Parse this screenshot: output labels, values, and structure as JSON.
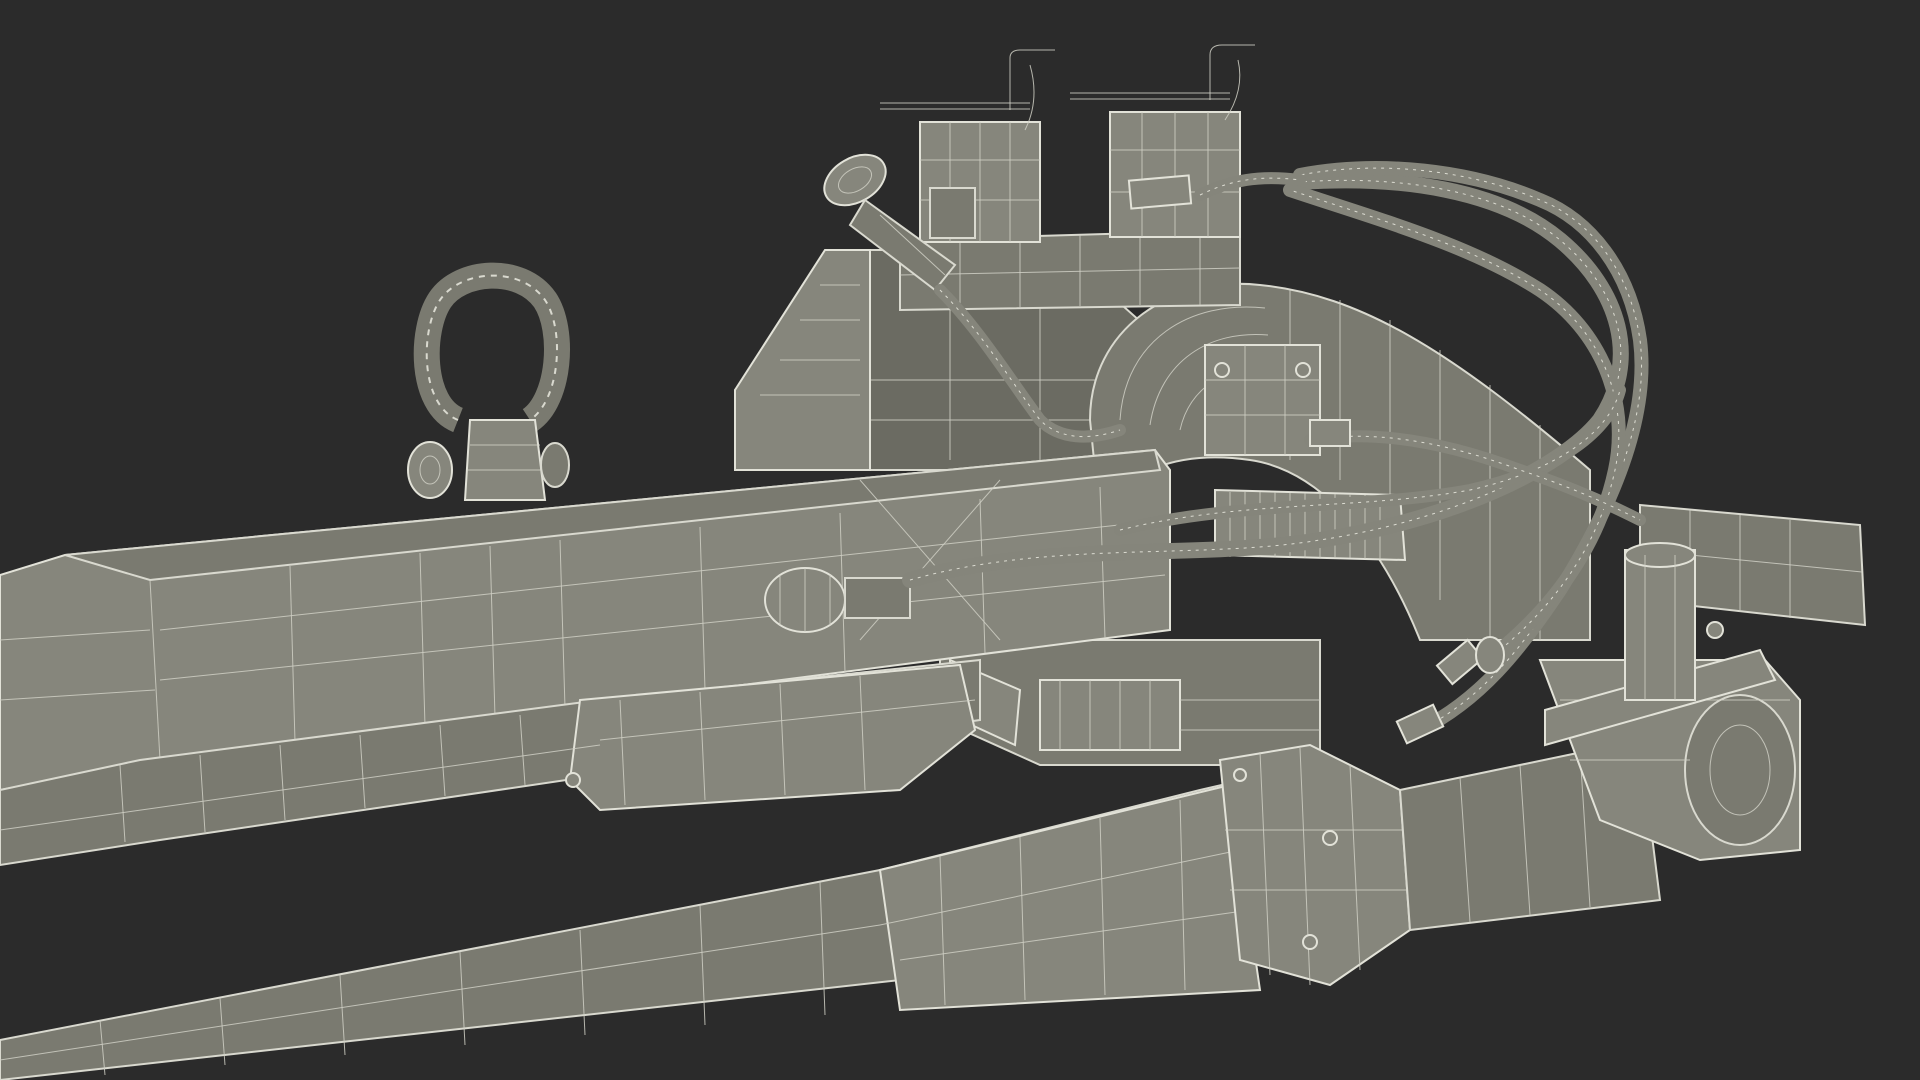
{
  "scene": {
    "subject": "wireframe-3d-render",
    "colors": {
      "background": "#2b2b2b",
      "surface": "#7a7a70",
      "wire": "#d9d9cf"
    }
  }
}
